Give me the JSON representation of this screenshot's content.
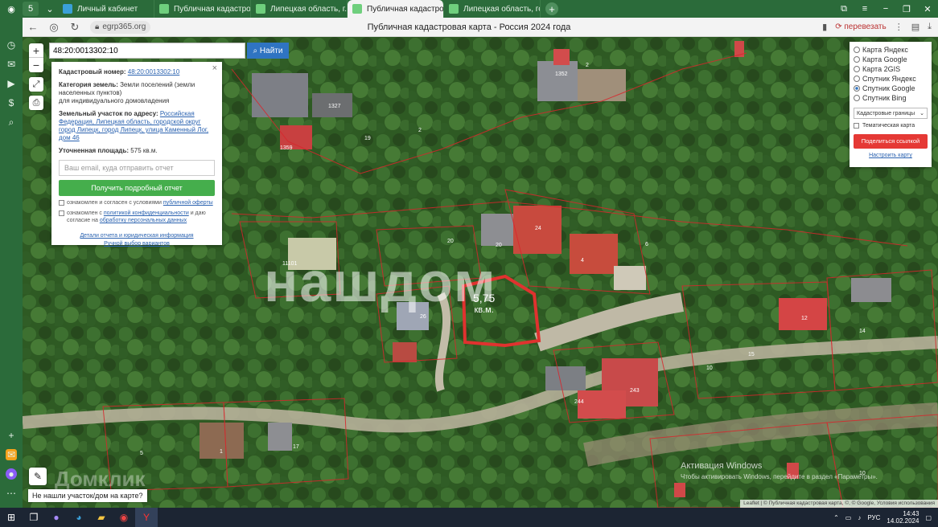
{
  "browser": {
    "tabs": [
      {
        "label": "Личный кабинет",
        "active": false
      },
      {
        "label": "Публичная кадастровая к",
        "active": false
      },
      {
        "label": "Липецкая область, г. Лип",
        "active": false
      },
      {
        "label": "Публичная кадастрова",
        "active": true
      },
      {
        "label": "Липецкая область, город",
        "active": false
      }
    ],
    "tab_close": "×",
    "new_tab": "+",
    "url": "egrp365.org",
    "page_title": "Публичная кадастровая карта - Россия 2024 года",
    "translate_label": "перевезать"
  },
  "search": {
    "value": "48:20:0013302:10",
    "button_label": "Найти"
  },
  "info": {
    "close": "×",
    "cadastral_label": "Кадастровый номер:",
    "cadastral_value": "48:20:0013302:10",
    "category_label": "Категория земель:",
    "category_value": "Земли поселений (земли населенных пунктов)",
    "category_use": "для индивидуального домовладения",
    "address_label": "Земельный участок по адресу:",
    "address_value": "Российская Федерация, Липецкая область, городской округ город Липецк, город Липецк, улица Каменный Лог, дом 46",
    "area_label": "Уточненная площадь:",
    "area_value": "575 кв.м.",
    "email_placeholder": "Ваш email, куда отправить отчет",
    "report_button": "Получить подробный отчет",
    "consent1_prefix": "ознакомлен и согласен с условиями",
    "consent1_link": "публичной оферты",
    "consent2_prefix": "ознакомлен с",
    "consent2_link1": "политикой конфиденциальности",
    "consent2_mid": "и даю согласие на",
    "consent2_link2": "обработку персональных данных",
    "link_details": "Детали отчета и юридическая информация",
    "link_manual": "Ручной выбор вариантов"
  },
  "layers": {
    "options": [
      {
        "label": "Карта Яндекс",
        "selected": false
      },
      {
        "label": "Карта Google",
        "selected": false
      },
      {
        "label": "Карта 2GIS",
        "selected": false
      },
      {
        "label": "Спутник Яндекс",
        "selected": false
      },
      {
        "label": "Спутник Google",
        "selected": true
      },
      {
        "label": "Спутник Bing",
        "selected": false
      }
    ],
    "boundaries_select": "Кадастровые границы",
    "select_arrow": "⌄",
    "thematic": "Тематическая карта",
    "share_button": "Поделиться ссылкой",
    "setup_link": "Настроить карту"
  },
  "map": {
    "zoom_in": "+",
    "zoom_out": "−",
    "watermark": "нашдом",
    "area_number": "5,75",
    "area_unit": "кв.м.",
    "dom_klik": "Домклик",
    "not_found": "Не нашли участок/дом на карте?",
    "attribution": "Leaflet | © Публичная кадастровая карта, ©, © Google, Условия использования",
    "activation_title": "Активация Windows",
    "activation_sub": "Чтобы активировать Windows, перейдите в раздел «Параметры».",
    "parcel_labels": [
      {
        "text": "1352"
      },
      {
        "text": "2"
      },
      {
        "text": "1327"
      },
      {
        "text": "1359"
      },
      {
        "text": "2"
      },
      {
        "text": "19"
      },
      {
        "text": "20"
      },
      {
        "text": "24"
      },
      {
        "text": "20"
      },
      {
        "text": "4"
      },
      {
        "text": "6"
      },
      {
        "text": "11101"
      },
      {
        "text": "26"
      },
      {
        "text": "14"
      },
      {
        "text": "12"
      },
      {
        "text": "15"
      },
      {
        "text": "10"
      },
      {
        "text": "244"
      },
      {
        "text": "243"
      },
      {
        "text": "17"
      },
      {
        "text": "1"
      },
      {
        "text": "5"
      },
      {
        "text": "10"
      }
    ]
  },
  "taskbar": {
    "lang": "РУС",
    "time": "14:43",
    "date": "14.02.2024"
  },
  "colors": {
    "chrome": "#2b6b3a",
    "boundary": "#d8262c",
    "report_button": "#45ae4c",
    "share_button": "#e53935",
    "search_button": "#2f74c2"
  }
}
